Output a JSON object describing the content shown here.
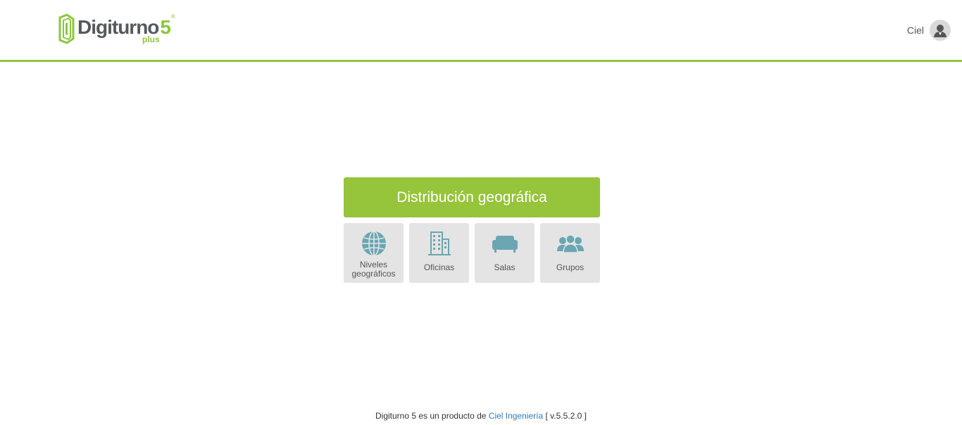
{
  "app": {
    "logo_word": "Digiturno",
    "logo_number": "5",
    "logo_reg": "®",
    "logo_suffix": "plus",
    "brand_color": "#96c43a"
  },
  "header": {
    "user_name": "Ciel",
    "avatar_icon": "user-avatar-icon"
  },
  "main": {
    "title": "Distribución geográfica",
    "tiles": [
      {
        "label": "Niveles geográficos",
        "icon": "globe-icon"
      },
      {
        "label": "Oficinas",
        "icon": "building-icon"
      },
      {
        "label": "Salas",
        "icon": "sofa-icon"
      },
      {
        "label": "Grupos",
        "icon": "group-icon"
      }
    ]
  },
  "footer": {
    "prefix": "Digiturno 5 es un producto de",
    "link": "Ciel Ingeniería",
    "version": "[ v.5.5.2.0 ]"
  },
  "colors": {
    "accent": "#96c43a",
    "icon": "#6aa6b4",
    "tile_bg": "#e4e4e4",
    "link": "#337ab7"
  }
}
